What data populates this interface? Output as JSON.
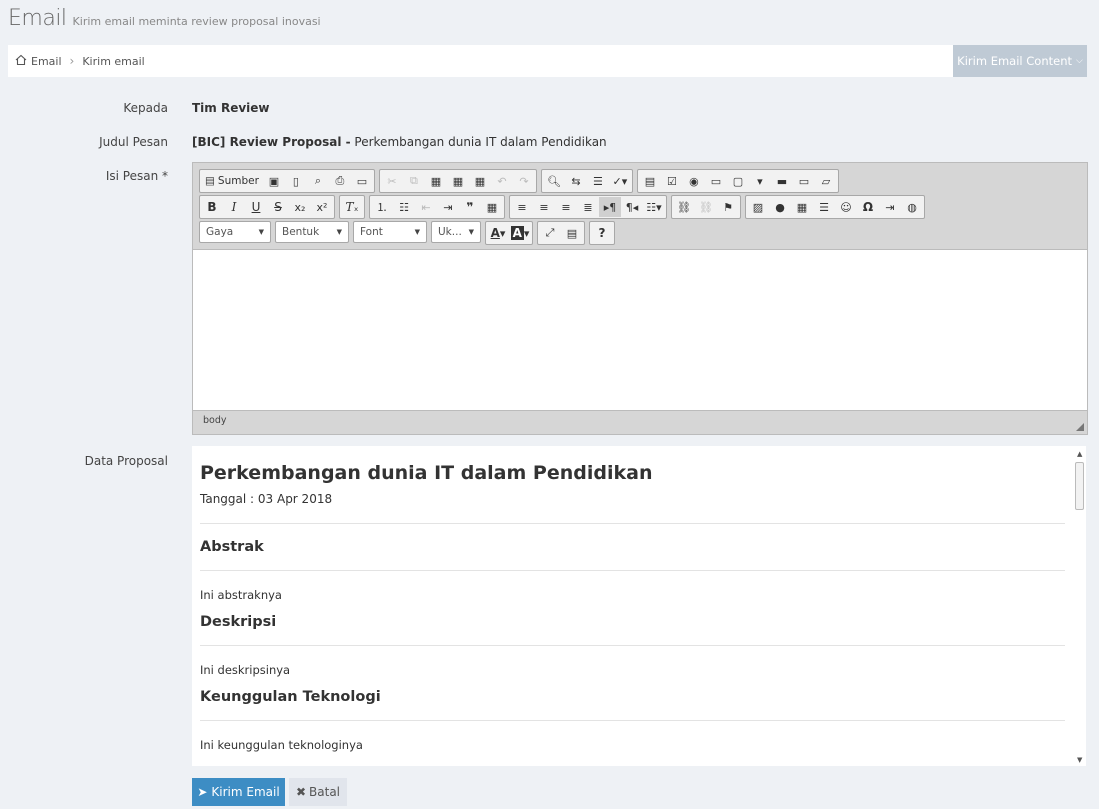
{
  "header": {
    "title": "Email",
    "subtitle": "Kirim email meminta review proposal inovasi"
  },
  "breadcrumb": {
    "home": "Email",
    "current": "Kirim email"
  },
  "actions": {
    "content_button": "Kirim Email Content"
  },
  "form": {
    "to_label": "Kepada",
    "to_value": "Tim Review",
    "subject_label": "Judul Pesan",
    "subject_bold": "[BIC] Review Proposal -",
    "subject_rest": " Perkembangan dunia IT dalam Pendidikan",
    "body_label": "Isi Pesan *",
    "data_label": "Data Proposal"
  },
  "editor": {
    "source_label": "Sumber",
    "style_combo": "Gaya",
    "format_combo": "Bentuk",
    "font_combo": "Font",
    "size_combo": "Uk...",
    "status_path": "body"
  },
  "proposal": {
    "title": "Perkembangan dunia IT dalam Pendidikan",
    "date": "Tanggal : 03 Apr 2018",
    "sections": [
      {
        "heading": "Abstrak",
        "text": "Ini abstraknya"
      },
      {
        "heading": "Deskripsi",
        "text": "Ini deskripsinya"
      },
      {
        "heading": "Keunggulan Teknologi",
        "text": "Ini keunggulan teknologinya"
      }
    ]
  },
  "buttons": {
    "send": "Kirim Email",
    "cancel": "Batal"
  }
}
